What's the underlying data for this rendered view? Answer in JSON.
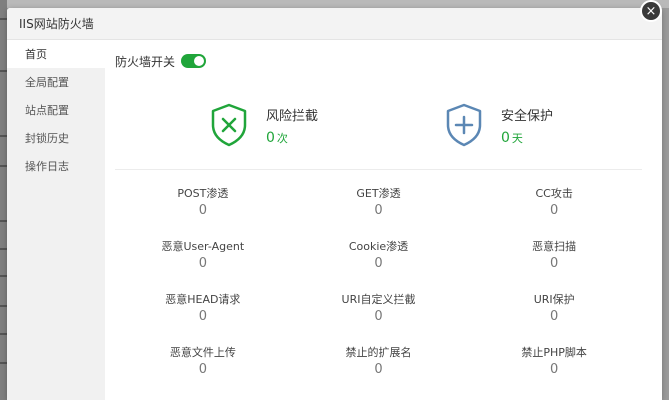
{
  "dialog": {
    "title": "IIS网站防火墙",
    "close_symbol": "×"
  },
  "sidebar": {
    "items": [
      {
        "label": "首页",
        "active": true
      },
      {
        "label": "全局配置"
      },
      {
        "label": "站点配置"
      },
      {
        "label": "封锁历史"
      },
      {
        "label": "操作日志"
      }
    ]
  },
  "main": {
    "firewall_switch": {
      "label": "防火墙开关",
      "enabled": true
    },
    "stats": [
      {
        "label": "风险拦截",
        "value": "0",
        "unit": "次",
        "icon": "shield-x-icon",
        "color": "#20a53a"
      },
      {
        "label": "安全保护",
        "value": "0",
        "unit": "天",
        "icon": "shield-plus-icon",
        "color": "#5b87b4"
      }
    ],
    "grid": [
      {
        "label": "POST渗透",
        "value": "0"
      },
      {
        "label": "GET渗透",
        "value": "0"
      },
      {
        "label": "CC攻击",
        "value": "0"
      },
      {
        "label": "恶意User-Agent",
        "value": "0"
      },
      {
        "label": "Cookie渗透",
        "value": "0"
      },
      {
        "label": "恶意扫描",
        "value": "0"
      },
      {
        "label": "恶意HEAD请求",
        "value": "0"
      },
      {
        "label": "URI自定义拦截",
        "value": "0"
      },
      {
        "label": "URI保护",
        "value": "0"
      },
      {
        "label": "恶意文件上传",
        "value": "0"
      },
      {
        "label": "禁止的扩展名",
        "value": "0"
      },
      {
        "label": "禁止PHP脚本",
        "value": "0"
      }
    ]
  },
  "colors": {
    "accent_green": "#20a53a",
    "accent_blue": "#5b87b4"
  }
}
